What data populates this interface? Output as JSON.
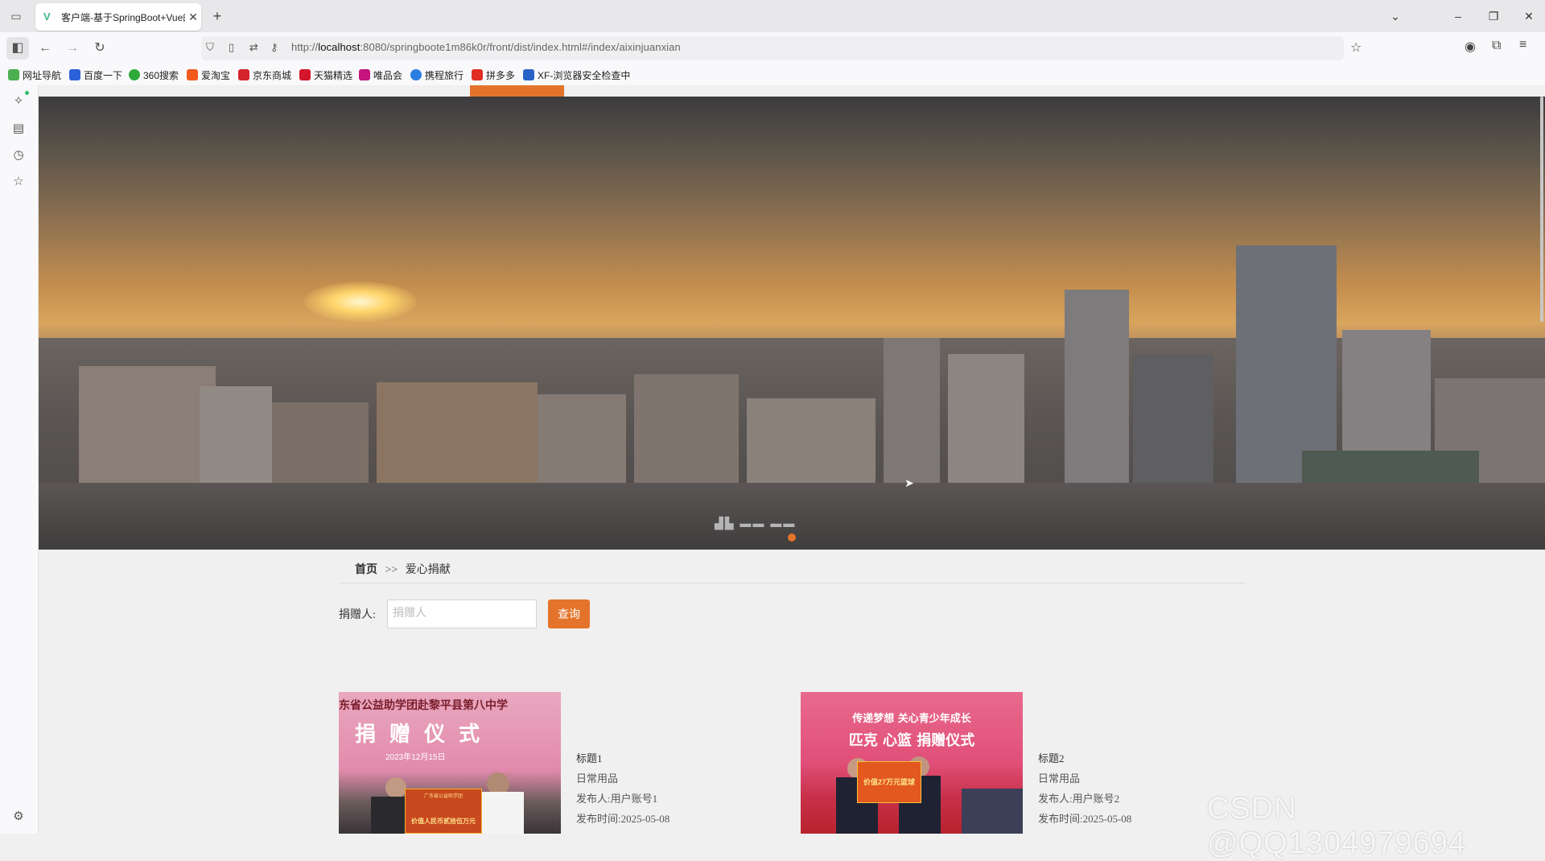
{
  "browser": {
    "tab_title": "客户端-基于SpringBoot+Vue的",
    "tab_close": "✕",
    "new_tab": "+",
    "url_prefix": "http://",
    "url_host": "localhost",
    "url_rest": ":8080/springboote1m86k0r/front/dist/index.html#/index/aixinjuanxian"
  },
  "bookmarks": [
    {
      "label": "网址导航",
      "color": "#4caf50"
    },
    {
      "label": "百度一下",
      "color": "#2b62d9"
    },
    {
      "label": "360搜索",
      "color": "#2faa3a"
    },
    {
      "label": "爱淘宝",
      "color": "#f25a1c"
    },
    {
      "label": "京东商城",
      "color": "#d4252c"
    },
    {
      "label": "天猫精选",
      "color": "#d4162c"
    },
    {
      "label": "唯品会",
      "color": "#c4157d"
    },
    {
      "label": "携程旅行",
      "color": "#2a7de1"
    },
    {
      "label": "拼多多",
      "color": "#e02e24"
    },
    {
      "label": "XF-浏览器安全检查中",
      "color": "#2962c5"
    }
  ],
  "breadcrumb": {
    "home": "首页",
    "separator": ">>",
    "current": "爱心捐献"
  },
  "search": {
    "label": "捐赠人:",
    "placeholder": "捐赠人",
    "button": "查询"
  },
  "cards": [
    {
      "title": "标题1",
      "category": "日常用品",
      "publisher": "发布人:用户账号1",
      "date": "发布时间:2025-05-08",
      "image_header": "东省公益助学团赴黎平县第八中学",
      "image_banner": "捐 赠 仪 式",
      "image_date": "2023年12月15日",
      "image_board_title": "广东省公益助学团",
      "image_board_value": "价值人民币贰拾伍万元"
    },
    {
      "title": "标题2",
      "category": "日常用品",
      "publisher": "发布人:用户账号2",
      "date": "发布时间:2025-05-08",
      "image_header": "传递梦想  关心青少年成长",
      "image_banner": "匹克  心篮  捐赠仪式",
      "image_board_value": "价值27万元篮球"
    }
  ],
  "overlay": {
    "watermark": "CSDN @QQ1304979694"
  },
  "colors": {
    "accent": "#e4742b"
  }
}
